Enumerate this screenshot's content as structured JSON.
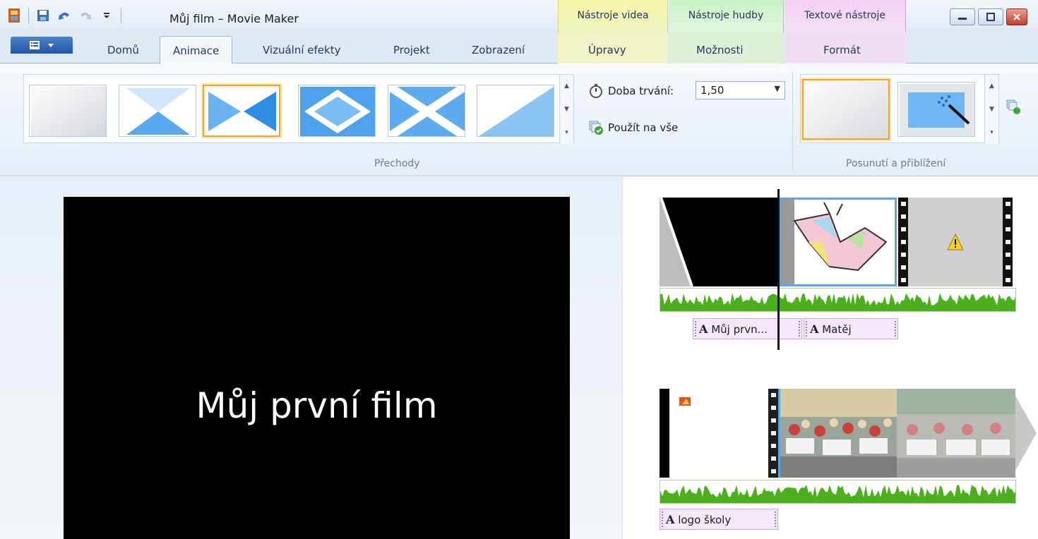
{
  "window": {
    "title": "Můj film – Movie Maker",
    "contextual_groups": [
      "Nástroje videa",
      "Nástroje hudby",
      "Textové nástroje"
    ]
  },
  "tabs": [
    {
      "label": "Domů",
      "active": false
    },
    {
      "label": "Animace",
      "active": true
    },
    {
      "label": "Vizuální efekty",
      "active": false
    },
    {
      "label": "Projekt",
      "active": false
    },
    {
      "label": "Zobrazení",
      "active": false
    },
    {
      "label": "Úpravy",
      "active": false
    },
    {
      "label": "Možnosti",
      "active": false
    },
    {
      "label": "Formát",
      "active": false
    }
  ],
  "ribbon": {
    "transitions_group_label": "Přechody",
    "duration_label": "Doba trvání:",
    "duration_value": "1,50",
    "apply_all_label": "Použít na vše",
    "pan_zoom_group_label": "Posunutí a přiblížení",
    "selected_transition_index": 2
  },
  "preview": {
    "text": "Můj první film"
  },
  "storyboard": {
    "captions_row1": [
      "Můj prvn...",
      "Matěj"
    ],
    "captions_row2": [
      "logo školy"
    ],
    "caption_glyph": "A"
  },
  "colors": {
    "accent_selected": "#f1a33a",
    "ribbon_bg": "#e4edf8",
    "audio_green": "#4caf1e"
  }
}
